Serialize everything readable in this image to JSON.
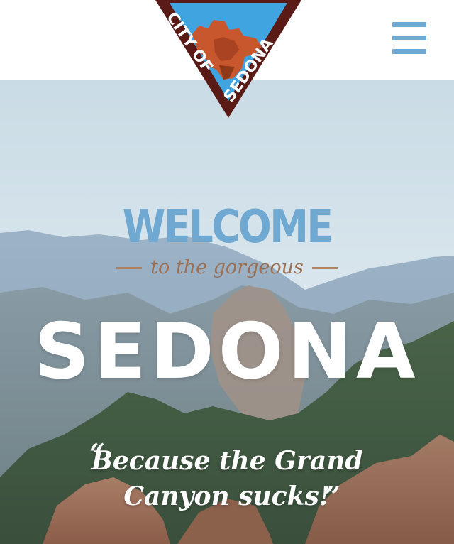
{
  "header": {
    "logo": {
      "top_text": "CITY",
      "left_text": "OF",
      "right_text": "SEDONA",
      "alt": "City of Sedona"
    },
    "menu_icon": "hamburger-menu-icon"
  },
  "hero": {
    "welcome": "WELCOME",
    "tagline": "to the gorgeous",
    "title": "SEDONA",
    "quote_line1": "Because the Grand",
    "quote_line2": "Canyon sucks!",
    "quote_open": "“",
    "quote_close": "”"
  },
  "colors": {
    "accent_blue": "#6fa8d0",
    "logo_maroon": "#5a1a16",
    "logo_sky": "#3fa4e0",
    "logo_rock": "#c9572e",
    "tagline_brown": "#9a6f52"
  }
}
